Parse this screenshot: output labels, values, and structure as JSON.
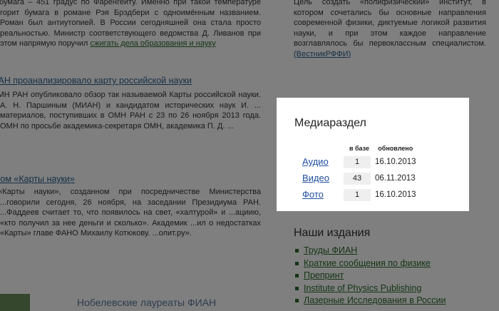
{
  "background": {
    "paragraph1_lines": "…бумага – 451 градус по Фаренгейту. Именно при такой температуре горит бумага в романе Рэя Брэдбери с одноимённым названием. Роман был антиутопией. В России сегодняшней она стала просто реальностью. Министр соответствующего ведомства Д. Ливанов при этом напрямую поручил",
    "paragraph1_link": "сжигать дела образования и науку",
    "heading1": "РАН проанализировало карту российской науки",
    "paragraph2": "ОМН РАН опубликовало обзор так называемой Карты российской науки. А. Н. Паршиным (МИАН) и кандидатом исторических наук И. ... материалов, поступивших в ОМН РАН с 23 по 26 ноября 2013 года. ОМН по просьбе академика-секретаря ОМН, академика П. Д. ...",
    "heading2": "...ом «Карты науки»",
    "paragraph3": "...«Карты науки», созданном при посредничестве Министерства ...говорили сегодня, 26 ноября, на заседании Президиума РАН. ...Фаддеев считает то, что появилось на свет, «халтурой» и ...ациию, «кто получил за нее деньги и сколько». Академик ...ил о недостатках «Карты» главе ФАНО Михаилу Котюкову. ...олит.ру».",
    "side_text": "Цель создать «полифизический» институт, в котором сочетались бы основные направления современной физики, диктуемые логикой развития науки, и при этом каждое направление возглавлялось бы первоклассным специалистом.",
    "side_link": "(ВестникРФФИ)",
    "pubs_title": "Наши издания",
    "pubs": [
      "Труды ФИАН",
      "Краткие сообщения по физике",
      "Препринт",
      "Institute of Physics Publishing",
      "Лазерные Исследования в России",
      "..."
    ],
    "footer_text": "Нобелевские лауреаты ФИАН"
  },
  "modal": {
    "title": "Медиараздел",
    "columns": {
      "count": "в базе",
      "updated": "обновлено"
    },
    "rows": [
      {
        "label": "Аудио",
        "count": "1",
        "date": "16.10.2013"
      },
      {
        "label": "Видео",
        "count": "43",
        "date": "06.11.2013"
      },
      {
        "label": "Фото",
        "count": "1",
        "date": "16.10.2013"
      }
    ]
  }
}
